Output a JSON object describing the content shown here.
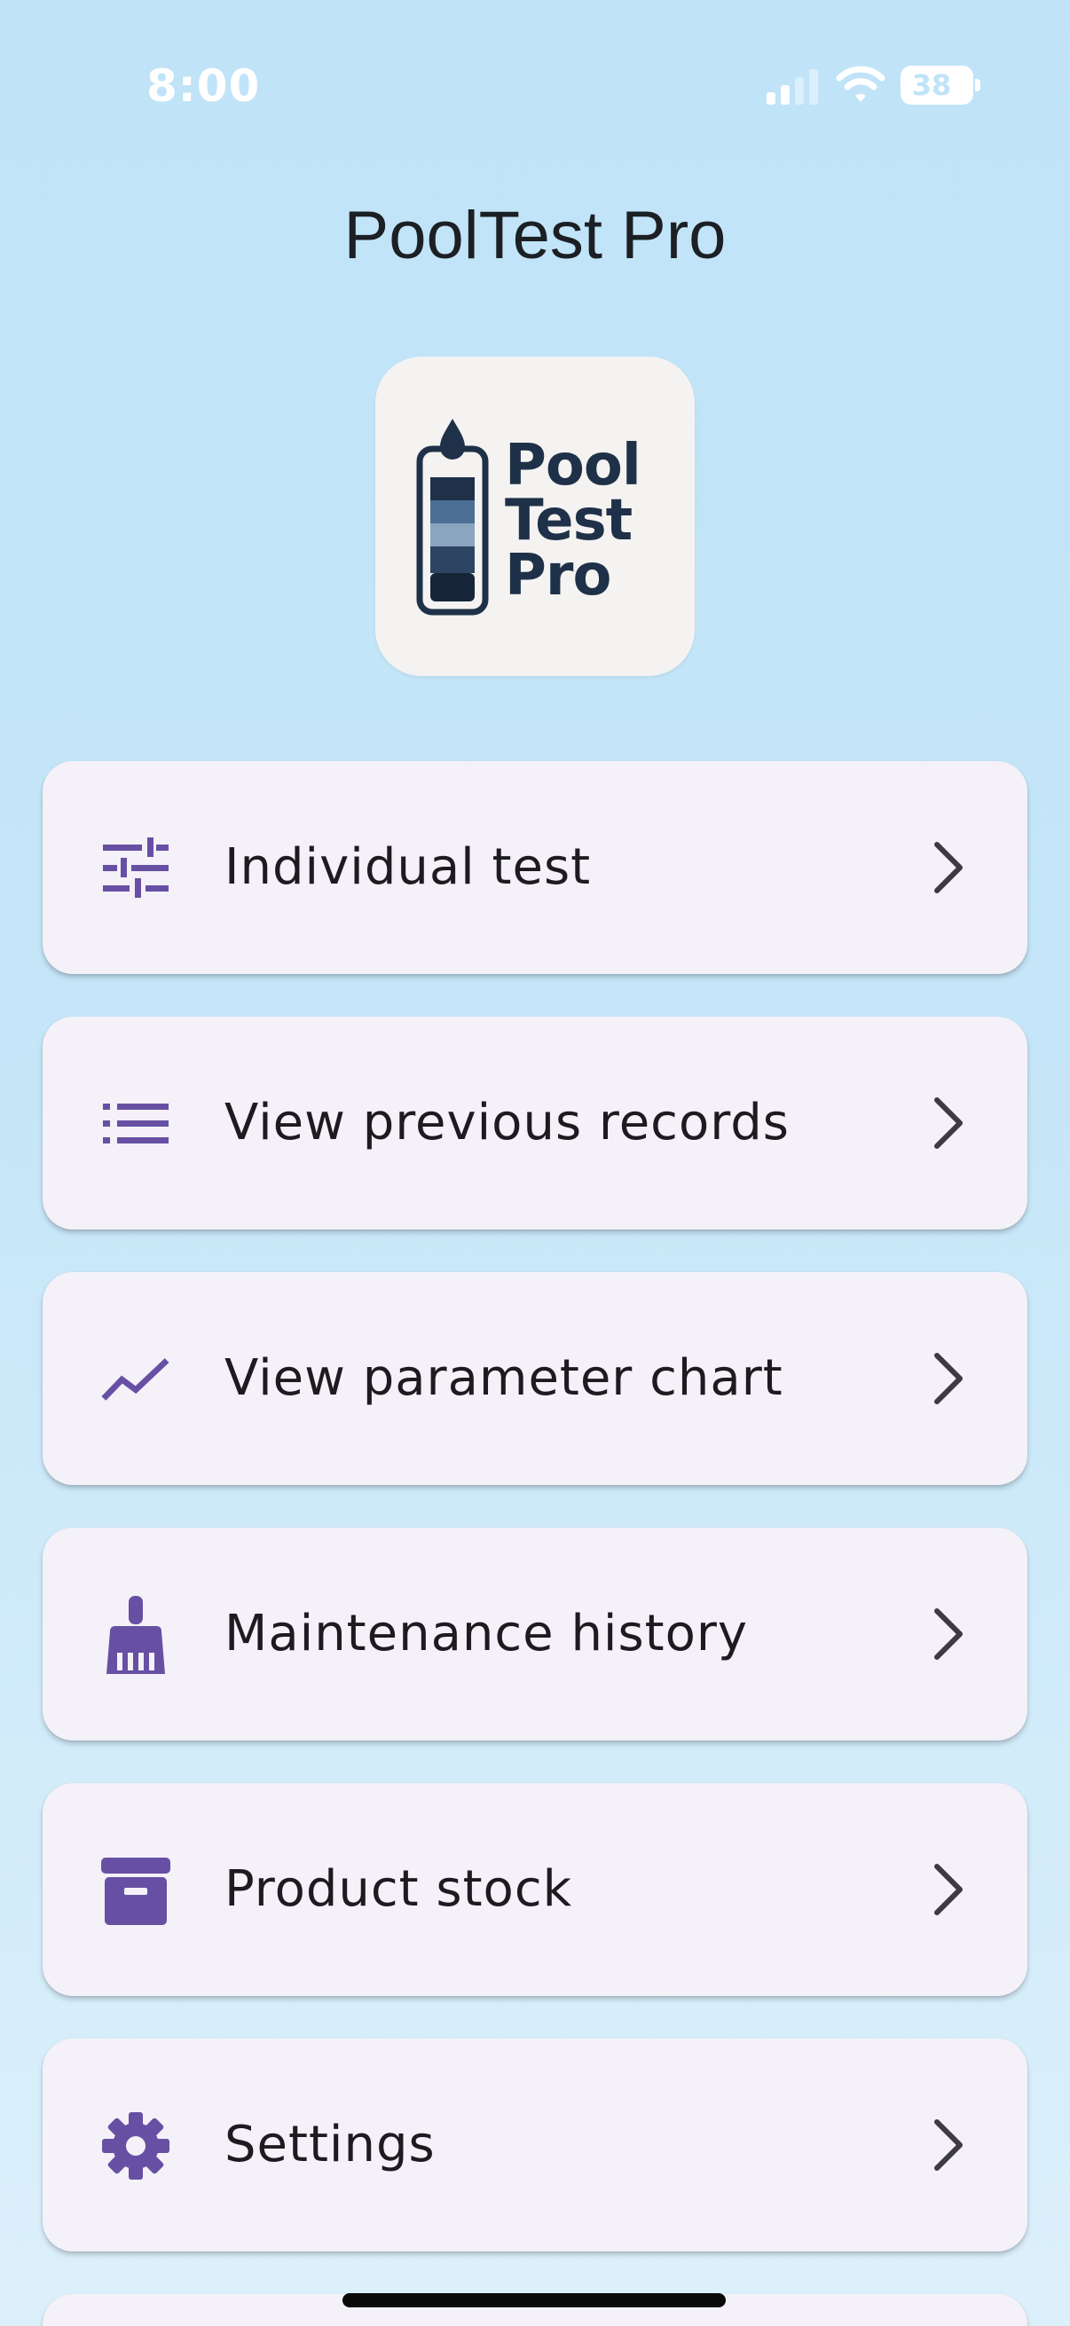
{
  "status_bar": {
    "time": "8:00",
    "battery": "38",
    "icons": [
      "cellular-signal-icon",
      "wifi-icon",
      "battery-icon"
    ]
  },
  "app": {
    "title": "PoolTest Pro",
    "logo_lines": [
      "Pool",
      "Test",
      "Pro"
    ]
  },
  "theme": {
    "accent": "#6750a4",
    "card_bg": "#f4f1f8",
    "text": "#1d1b20",
    "logo_navy": "#1f3148"
  },
  "menu": [
    {
      "label": "Individual test",
      "icon": "tune-sliders-icon"
    },
    {
      "label": "View previous records",
      "icon": "list-icon"
    },
    {
      "label": "View parameter chart",
      "icon": "trending-line-icon"
    },
    {
      "label": "Maintenance history",
      "icon": "broom-icon"
    },
    {
      "label": "Product stock",
      "icon": "archive-box-icon"
    },
    {
      "label": "Settings",
      "icon": "gear-icon"
    }
  ]
}
